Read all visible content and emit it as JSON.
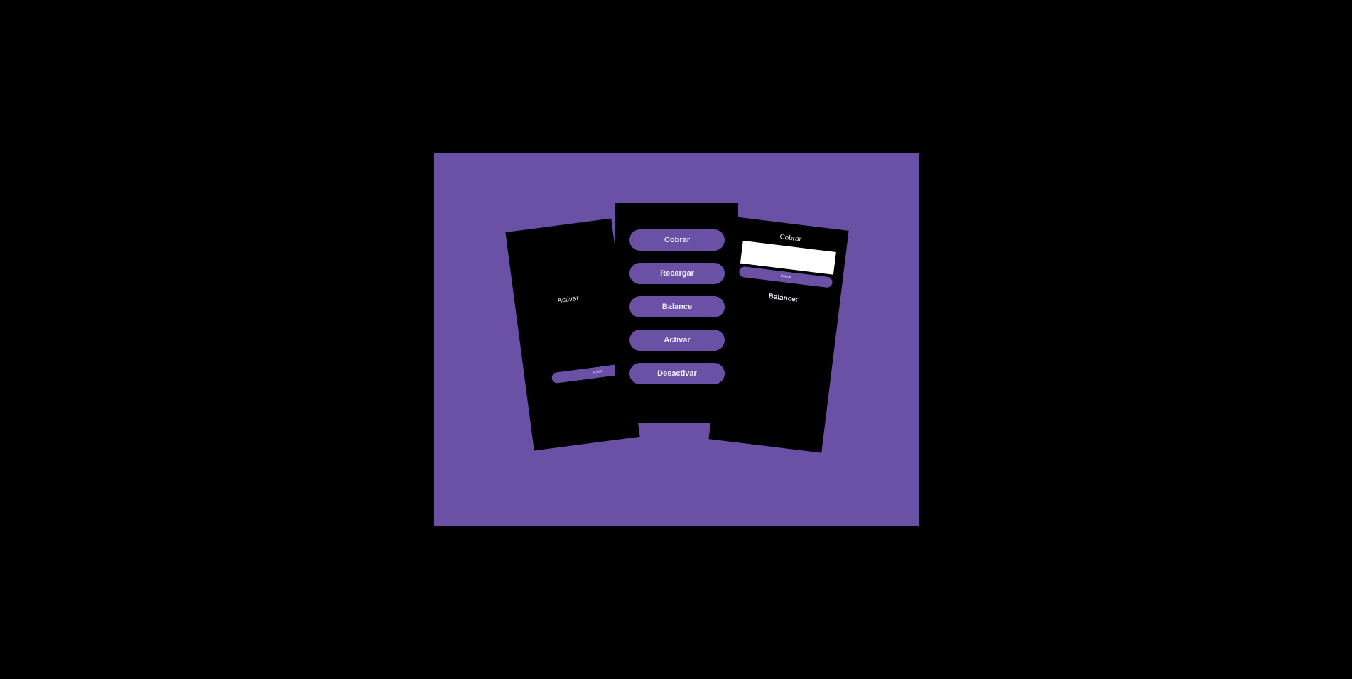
{
  "colors": {
    "background": "#000000",
    "stage": "#6a51a6",
    "phone": "#000000",
    "button": "#6a51a6",
    "text": "#f1eef8"
  },
  "left_phone": {
    "title": "Activar",
    "button_label": "Activar"
  },
  "center_phone": {
    "menu": [
      {
        "label": "Cobrar"
      },
      {
        "label": "Recargar"
      },
      {
        "label": "Balance"
      },
      {
        "label": "Activar"
      },
      {
        "label": "Desactivar"
      }
    ]
  },
  "right_phone": {
    "title": "Cobrar",
    "input_value": "",
    "button_label": "Cobrar",
    "balance_label": "Balance:"
  }
}
